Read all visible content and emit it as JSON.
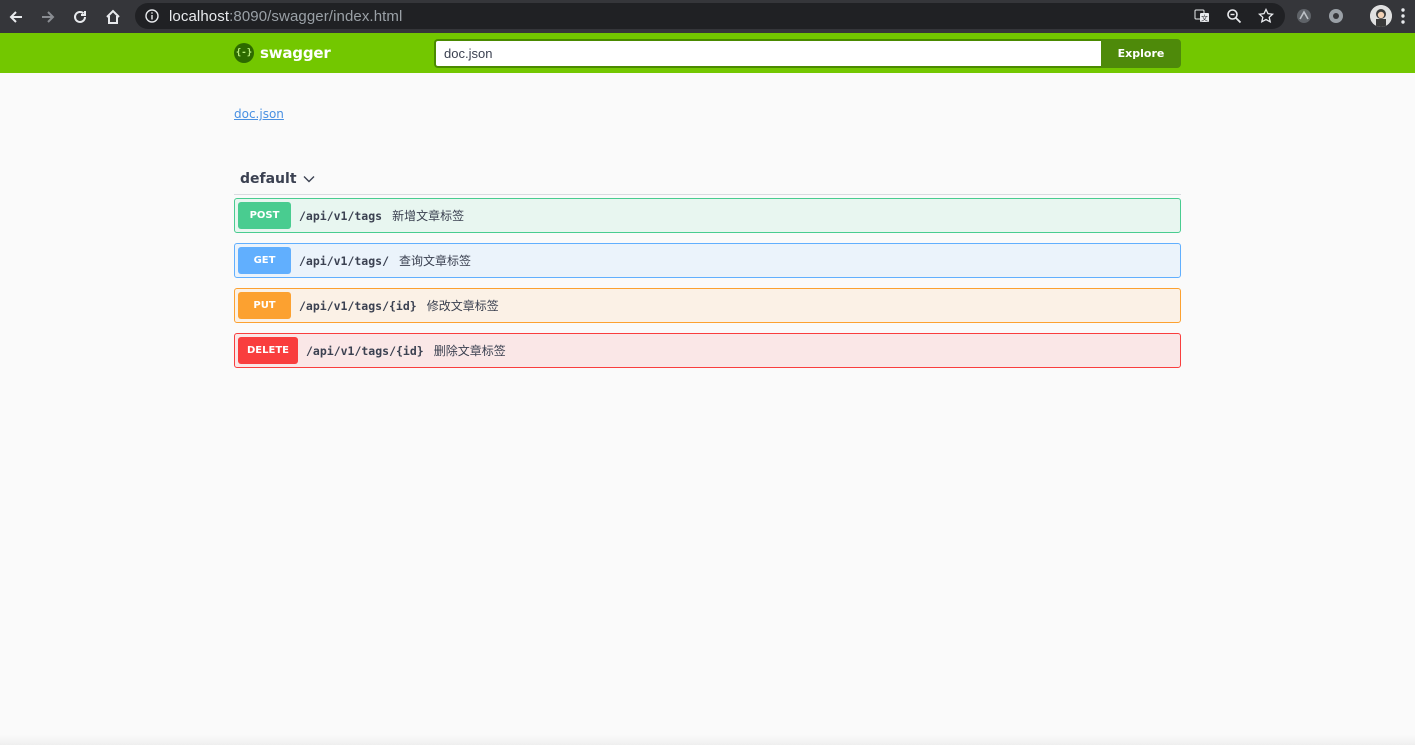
{
  "browser": {
    "url_host": "localhost",
    "url_rest": ":8090/swagger/index.html"
  },
  "topbar": {
    "logo_text": "swagger",
    "logo_mark": "{-}",
    "search_value": "doc.json",
    "explore_label": "Explore",
    "bar_color": "#73c700",
    "explore_color": "#4e8a0a"
  },
  "main": {
    "spec_link": "doc.json",
    "tag": {
      "name": "default",
      "icon": "chevron-down-icon"
    },
    "operations": [
      {
        "method": "POST",
        "path": "/api/v1/tags",
        "summary": "新增文章标签",
        "color": "#49cc90",
        "bg": "#e8f6f0"
      },
      {
        "method": "GET",
        "path": "/api/v1/tags/",
        "summary": "查询文章标签",
        "color": "#61affe",
        "bg": "#ebf3fb"
      },
      {
        "method": "PUT",
        "path": "/api/v1/tags/{id}",
        "summary": "修改文章标签",
        "color": "#fca130",
        "bg": "#fbf1e6"
      },
      {
        "method": "DELETE",
        "path": "/api/v1/tags/{id}",
        "summary": "删除文章标签",
        "color": "#f93e3e",
        "bg": "#fae7e7"
      }
    ]
  }
}
